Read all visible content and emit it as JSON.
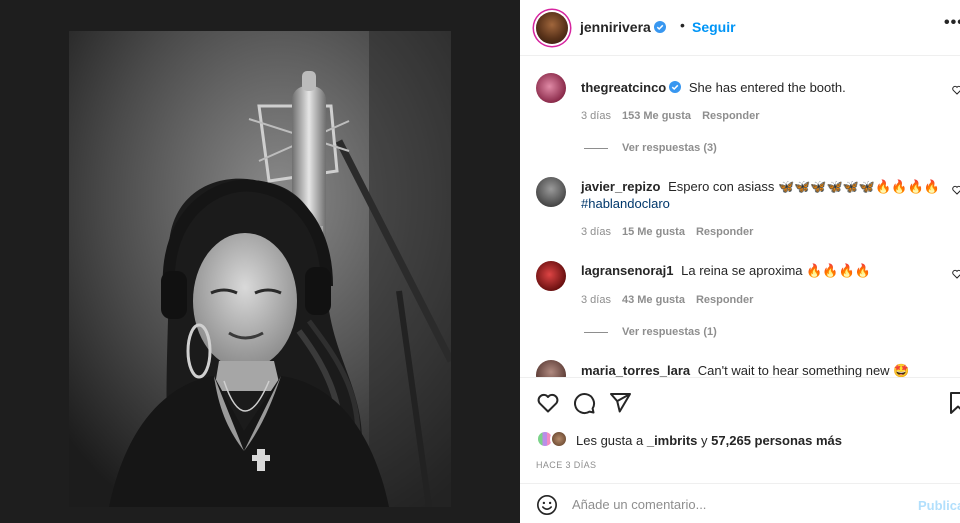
{
  "post": {
    "username": "jennirivera",
    "follow_label": "Seguir",
    "more_icon": "more-horizontal-icon",
    "separator": "•"
  },
  "comments": [
    {
      "username": "thegreatcinco",
      "verified": true,
      "text": "She has entered the booth.",
      "time": "3 días",
      "likes": "153 Me gusta",
      "reply_label": "Responder",
      "view_replies": "Ver respuestas (3)"
    },
    {
      "username": "javier_repizo",
      "verified": false,
      "text": "Espero con asiass 🦋🦋🦋🦋🦋🦋🔥🔥🔥🔥",
      "hashtag": "#hablandoclaro",
      "time": "3 días",
      "likes": "15 Me gusta",
      "reply_label": "Responder"
    },
    {
      "username": "lagransenoraj1",
      "verified": false,
      "text": "La reina se aproxima 🔥🔥🔥🔥",
      "time": "3 días",
      "likes": "43 Me gusta",
      "reply_label": "Responder",
      "view_replies": "Ver respuestas (1)"
    },
    {
      "username": "maria_torres_lara",
      "verified": false,
      "text": "Can't wait to hear something new 🤩"
    }
  ],
  "actions": {
    "like_icon": "heart-icon",
    "comment_icon": "comment-icon",
    "share_icon": "share-icon",
    "save_icon": "bookmark-icon"
  },
  "likes": {
    "prefix": "Les gusta a",
    "user": "_imbrits",
    "joiner": "y",
    "count_text": "57,265 personas más"
  },
  "timestamp": "HACE 3 DÍAS",
  "add_comment": {
    "placeholder": "Añade un comentario...",
    "post_label": "Publicar"
  },
  "colors": {
    "accent": "#0095f6",
    "verified": "#3897f0",
    "muted": "#8e8e8e",
    "text": "#262626"
  }
}
